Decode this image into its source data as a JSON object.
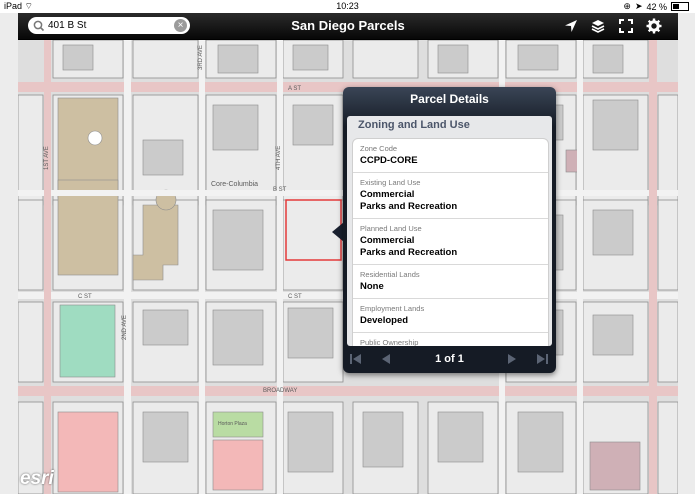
{
  "status_bar": {
    "device": "iPad",
    "time": "10:23",
    "battery": "42 %"
  },
  "nav": {
    "title": "San Diego Parcels",
    "search_value": "401 B St"
  },
  "map": {
    "streets": [
      "Core-Columbia",
      "A ST",
      "B ST",
      "C ST",
      "BROADWAY",
      "1ST AVE",
      "2ND AVE",
      "3RD AVE",
      "4TH AVE"
    ],
    "place_label": "Horton Plaza",
    "attribution": "esri"
  },
  "popup": {
    "title": "Parcel Details",
    "section": "Zoning and Land Use",
    "fields": [
      {
        "label": "Zone Code",
        "value": "CCPD-CORE"
      },
      {
        "label": "Existing Land Use",
        "value": "Commercial",
        "value2": "Parks and Recreation"
      },
      {
        "label": "Planned Land Use",
        "value": "Commercial",
        "value2": "Parks and Recreation"
      },
      {
        "label": "Residential Lands",
        "value": "None"
      },
      {
        "label": "Employment Lands",
        "value": "Developed"
      },
      {
        "label": "Public Ownership",
        "value": ""
      }
    ],
    "pager": "1 of 1"
  },
  "colors": {
    "major_road": "#e8c6c6",
    "minor_road": "#f6f6f6",
    "parcel": "#e2e2e2",
    "building": "#cfcfcf",
    "tan": "#cdbfa2",
    "green": "#9fdcc1",
    "pink": "#f3b8b8",
    "selected": "#e53a3a"
  }
}
